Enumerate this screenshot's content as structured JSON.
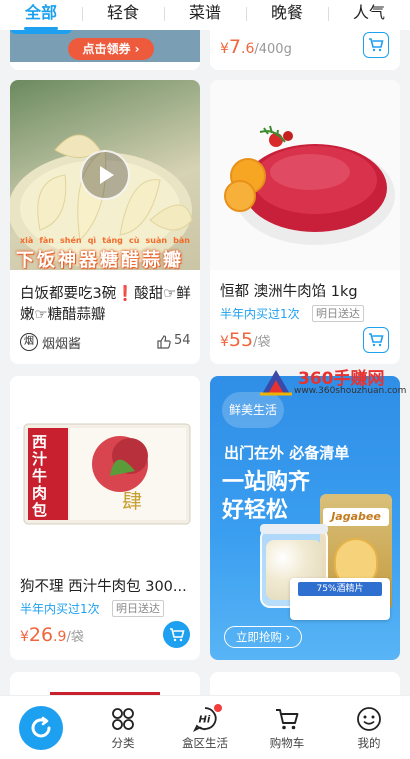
{
  "tabs": [
    {
      "label": "全部",
      "active": true
    },
    {
      "label": "轻食"
    },
    {
      "label": "菜谱"
    },
    {
      "label": "晚餐"
    },
    {
      "label": "人气"
    }
  ],
  "top_left_card": {
    "coupon_button": "点击领券 ›"
  },
  "top_right_card": {
    "currency": "¥",
    "price_int": "7",
    "price_dec": ".6",
    "unit": "/400g"
  },
  "recipe_card": {
    "pinyin": [
      "xià",
      "fàn",
      "shén",
      "qì",
      "táng",
      "cù",
      "suàn",
      "bàn"
    ],
    "caption": "下饭神器糖醋蒜瓣",
    "title": "白饭都要吃3碗❗️酸甜☞鲜嫩☞糖醋蒜瓣",
    "author": "烟烟酱",
    "author_avatar": "烟",
    "likes": "54"
  },
  "beef_card": {
    "title": "恒都 澳洲牛肉馅 1kg",
    "bought": "半年内买过1次",
    "tag": "明日送达",
    "currency": "¥",
    "price": "55",
    "unit": "/袋"
  },
  "bun_card": {
    "package_text": "西汁牛肉包",
    "title": "狗不理 西汁牛肉包 300...",
    "bought": "半年内买过1次",
    "tag": "明日送达",
    "currency": "¥",
    "price_int": "26",
    "price_dec": ".9",
    "unit": "/袋"
  },
  "ad_card": {
    "badge": "鲜美生活",
    "headline1": "出门在外 必备清单",
    "headline2": "一站购齐",
    "headline3": "好轻松",
    "cta": "立即抢购 ›",
    "product_brand": "Jagabee",
    "product_label": "75%酒精片"
  },
  "watermark": {
    "title": "360手赚网",
    "url": "www.360shouzhuan.com"
  },
  "nav": [
    {
      "label": "",
      "icon": "home-refresh-icon",
      "active": true
    },
    {
      "label": "分类",
      "icon": "category-icon"
    },
    {
      "label": "盒区生活",
      "icon": "hi-chat-icon"
    },
    {
      "label": "购物车",
      "icon": "cart-icon"
    },
    {
      "label": "我的",
      "icon": "profile-icon"
    }
  ],
  "colors": {
    "accent": "#1ea0f0",
    "price": "#f0663c"
  }
}
